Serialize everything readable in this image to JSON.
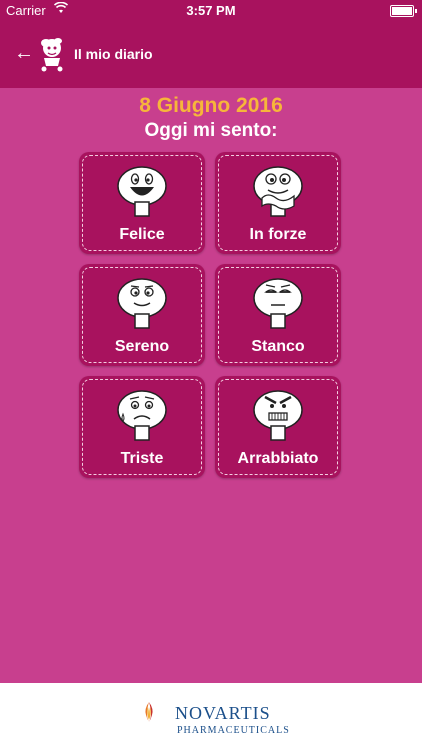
{
  "status_bar": {
    "carrier": "Carrier",
    "time": "3:57 PM",
    "wifi_icon": "wifi-icon",
    "battery_icon": "battery-icon"
  },
  "nav": {
    "title": "Il mio diario",
    "back_icon": "back-arrow-icon",
    "mascot_icon": "mascot-icon"
  },
  "header": {
    "date": "8 Giugno 2016",
    "subtitle": "Oggi mi sento:"
  },
  "moods": [
    {
      "label": "Felice",
      "icon": "happy-face-icon"
    },
    {
      "label": "In forze",
      "icon": "strong-face-icon"
    },
    {
      "label": "Sereno",
      "icon": "calm-face-icon"
    },
    {
      "label": "Stanco",
      "icon": "tired-face-icon"
    },
    {
      "label": "Triste",
      "icon": "sad-face-icon"
    },
    {
      "label": "Arrabbiato",
      "icon": "angry-face-icon"
    }
  ],
  "footer": {
    "brand": "NOVARTIS",
    "sub": "PHARMACEUTICALS",
    "logo_icon": "novartis-logo-icon"
  },
  "colors": {
    "background": "#c83f8e",
    "bar": "#a8125e",
    "date": "#f7b63a",
    "brand": "#1b4f8a"
  }
}
